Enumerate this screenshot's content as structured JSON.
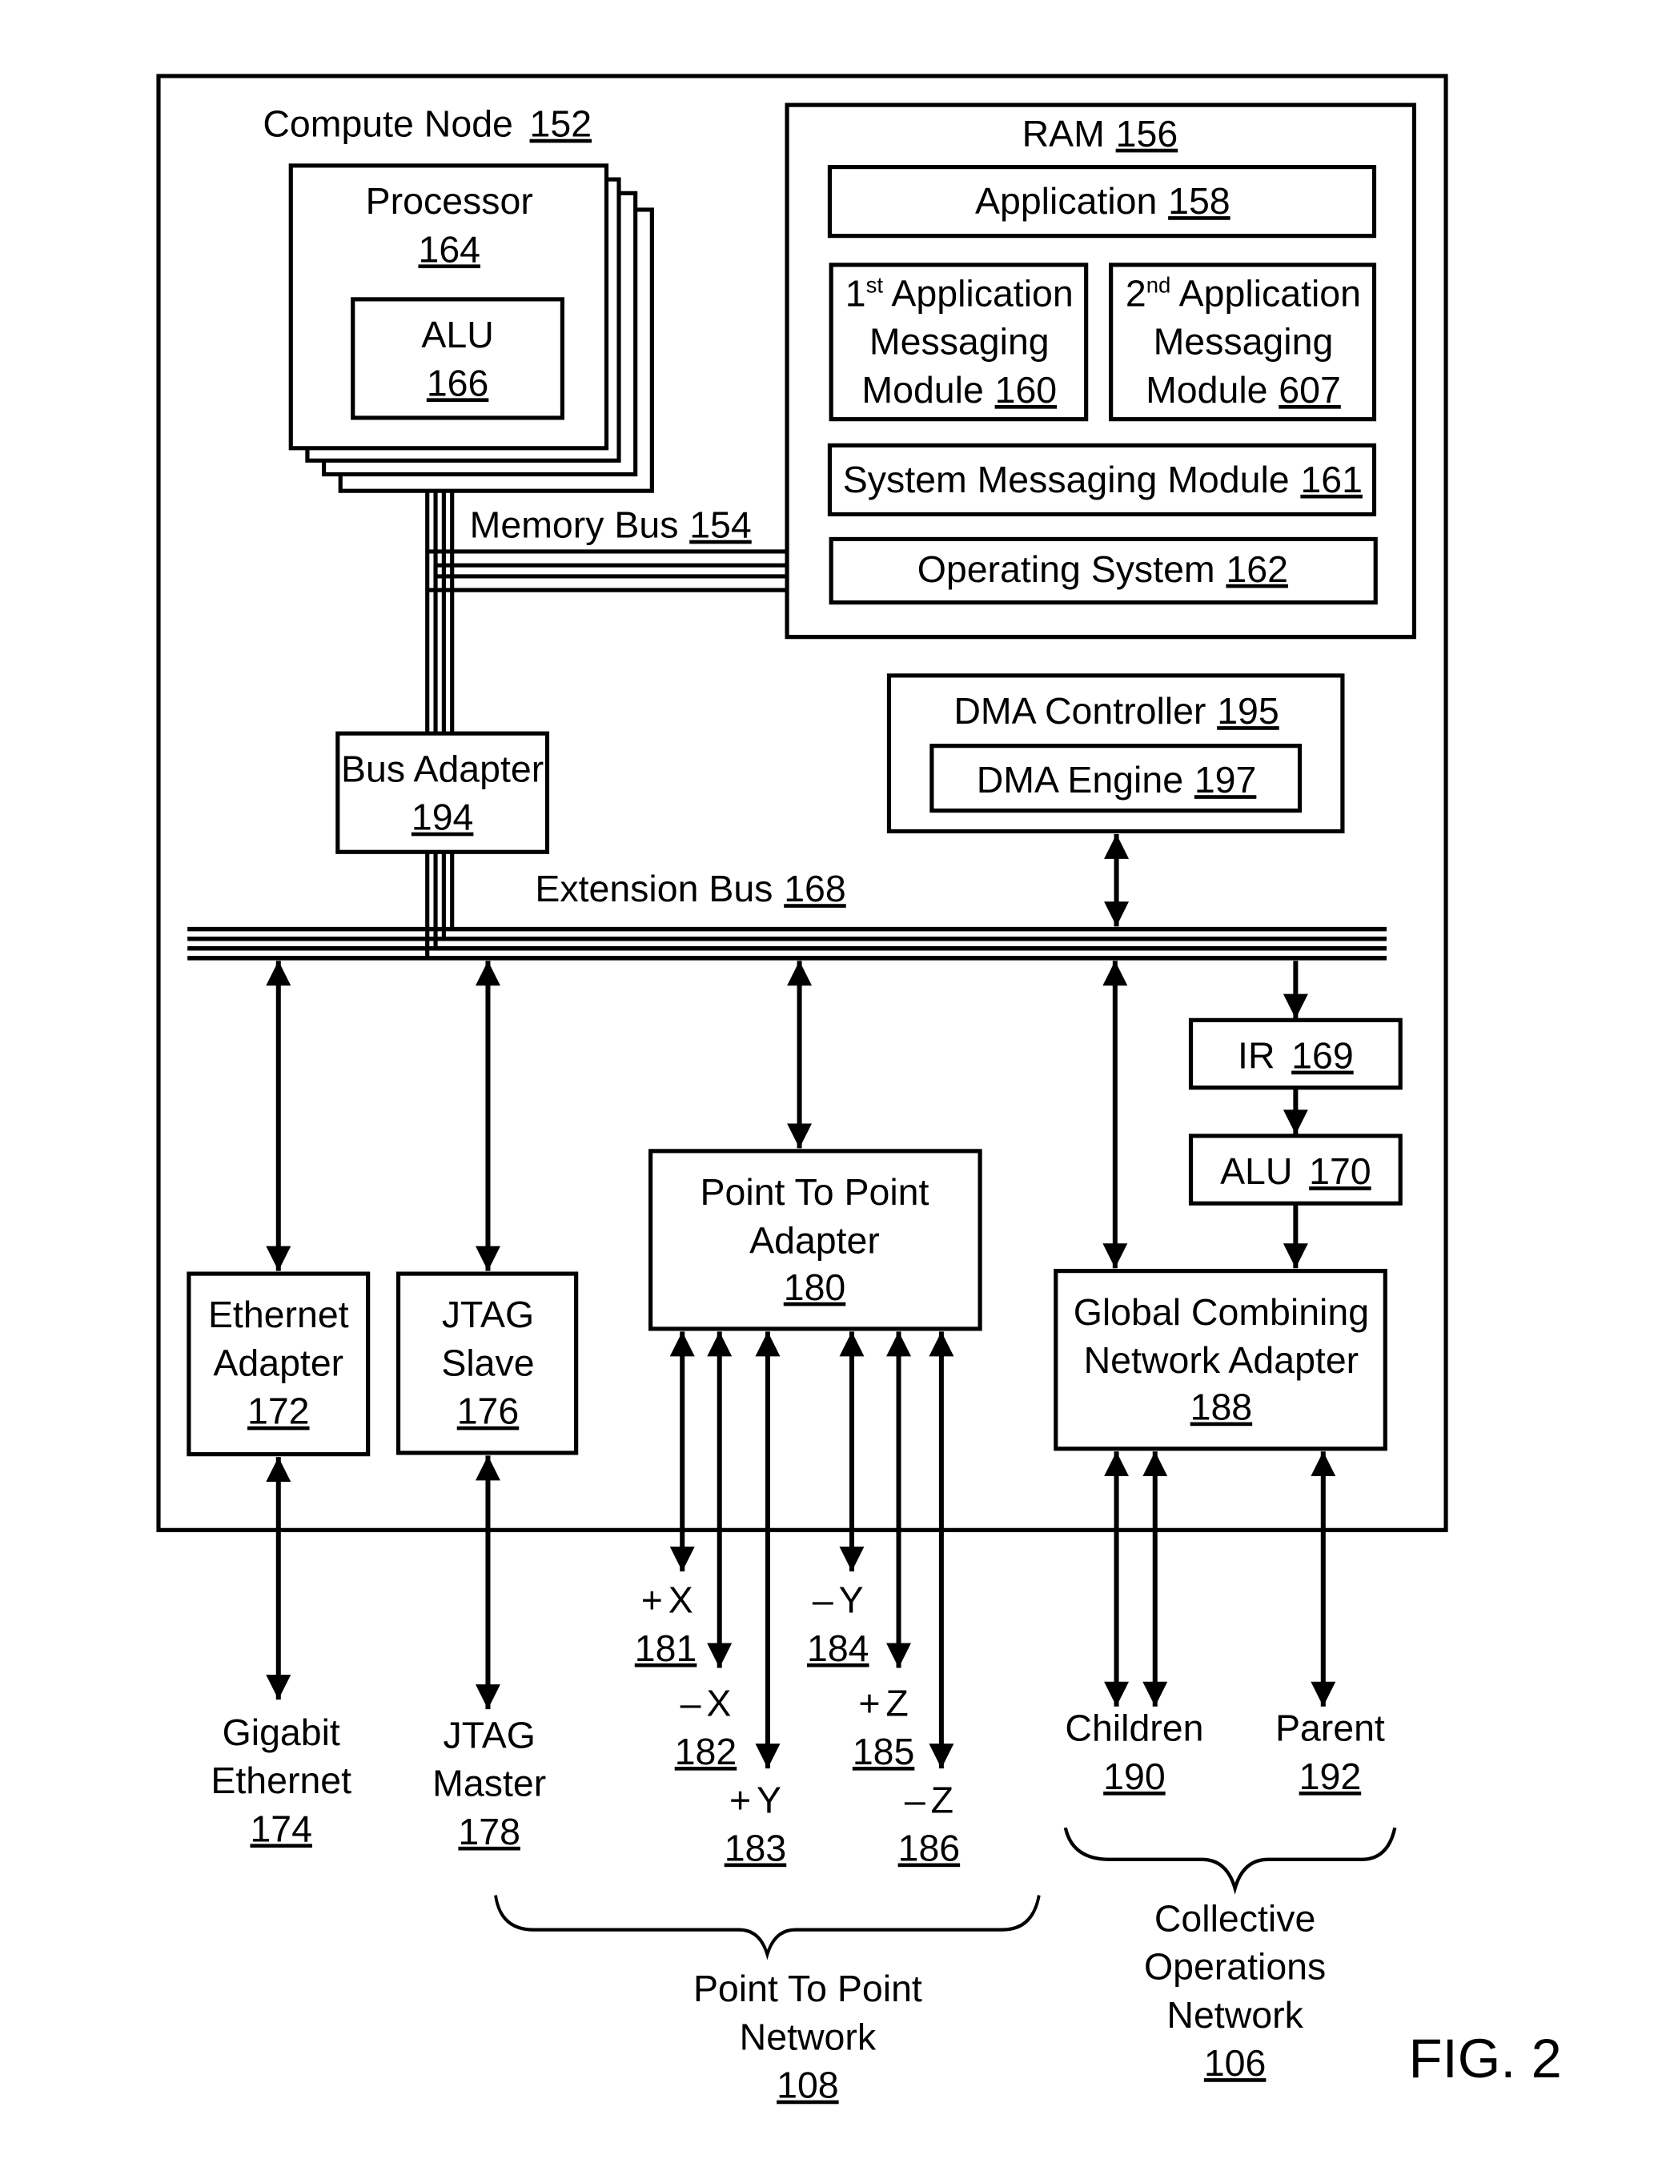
{
  "figure_label": "FIG. 2",
  "compute_node": {
    "label": "Compute Node",
    "ref": "152"
  },
  "processor": {
    "label": "Processor",
    "ref": "164"
  },
  "processor_alu": {
    "label": "ALU",
    "ref": "166"
  },
  "memory_bus": {
    "label": "Memory Bus",
    "ref": "154"
  },
  "ram": {
    "label": "RAM",
    "ref": "156",
    "application": {
      "label": "Application",
      "ref": "158"
    },
    "first_app_messaging": {
      "ordinal": "1",
      "suffix": "st",
      "line1": "Application",
      "line2": "Messaging",
      "line3": "Module",
      "ref": "160"
    },
    "second_app_messaging": {
      "ordinal": "2",
      "suffix": "nd",
      "line1": "Application",
      "line2": "Messaging",
      "line3": "Module",
      "ref": "607"
    },
    "system_messaging": {
      "label": "System Messaging Module",
      "ref": "161"
    },
    "operating_system": {
      "label": "Operating System",
      "ref": "162"
    }
  },
  "bus_adapter": {
    "label": "Bus Adapter",
    "ref": "194"
  },
  "dma_controller": {
    "label": "DMA Controller",
    "ref": "195"
  },
  "dma_engine": {
    "label": "DMA Engine",
    "ref": "197"
  },
  "extension_bus": {
    "label": "Extension Bus",
    "ref": "168"
  },
  "ir": {
    "label": "IR",
    "ref": "169"
  },
  "collective_alu": {
    "label": "ALU",
    "ref": "170"
  },
  "ethernet_adapter": {
    "line1": "Ethernet",
    "line2": "Adapter",
    "ref": "172"
  },
  "jtag_slave": {
    "line1": "JTAG",
    "line2": "Slave",
    "ref": "176"
  },
  "p2p_adapter": {
    "line1": "Point To Point",
    "line2": "Adapter",
    "ref": "180"
  },
  "gcn_adapter": {
    "line1": "Global Combining",
    "line2": "Network Adapter",
    "ref": "188"
  },
  "gigabit_ethernet": {
    "line1": "Gigabit",
    "line2": "Ethernet",
    "ref": "174"
  },
  "jtag_master": {
    "line1": "JTAG",
    "line2": "Master",
    "ref": "178"
  },
  "directions": [
    {
      "sign": "+",
      "axis": "X",
      "ref": "181"
    },
    {
      "sign": "–",
      "axis": "X",
      "ref": "182"
    },
    {
      "sign": "+",
      "axis": "Y",
      "ref": "183"
    },
    {
      "sign": "–",
      "axis": "Y",
      "ref": "184"
    },
    {
      "sign": "+",
      "axis": "Z",
      "ref": "185"
    },
    {
      "sign": "–",
      "axis": "Z",
      "ref": "186"
    }
  ],
  "children": {
    "label": "Children",
    "ref": "190"
  },
  "parent": {
    "label": "Parent",
    "ref": "192"
  },
  "p2p_network": {
    "line1": "Point To Point",
    "line2": "Network",
    "ref": "108"
  },
  "collective_network": {
    "line1": "Collective",
    "line2": "Operations",
    "line3": "Network",
    "ref": "106"
  }
}
